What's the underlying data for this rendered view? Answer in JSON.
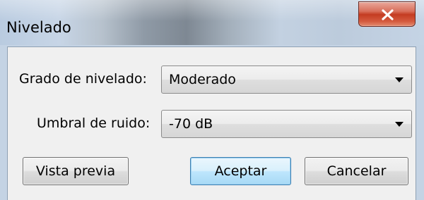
{
  "window": {
    "title": "Nivelado",
    "close_icon": "close-icon"
  },
  "form": {
    "leveling_label": "Grado de nivelado:",
    "leveling_value": "Moderado",
    "noise_label": "Umbral de ruido:",
    "noise_value": "-70 dB"
  },
  "buttons": {
    "preview": "Vista previa",
    "accept": "Aceptar",
    "cancel": "Cancelar"
  },
  "colors": {
    "close_button": "#c43c22",
    "default_button_border": "#3c7fb1"
  }
}
